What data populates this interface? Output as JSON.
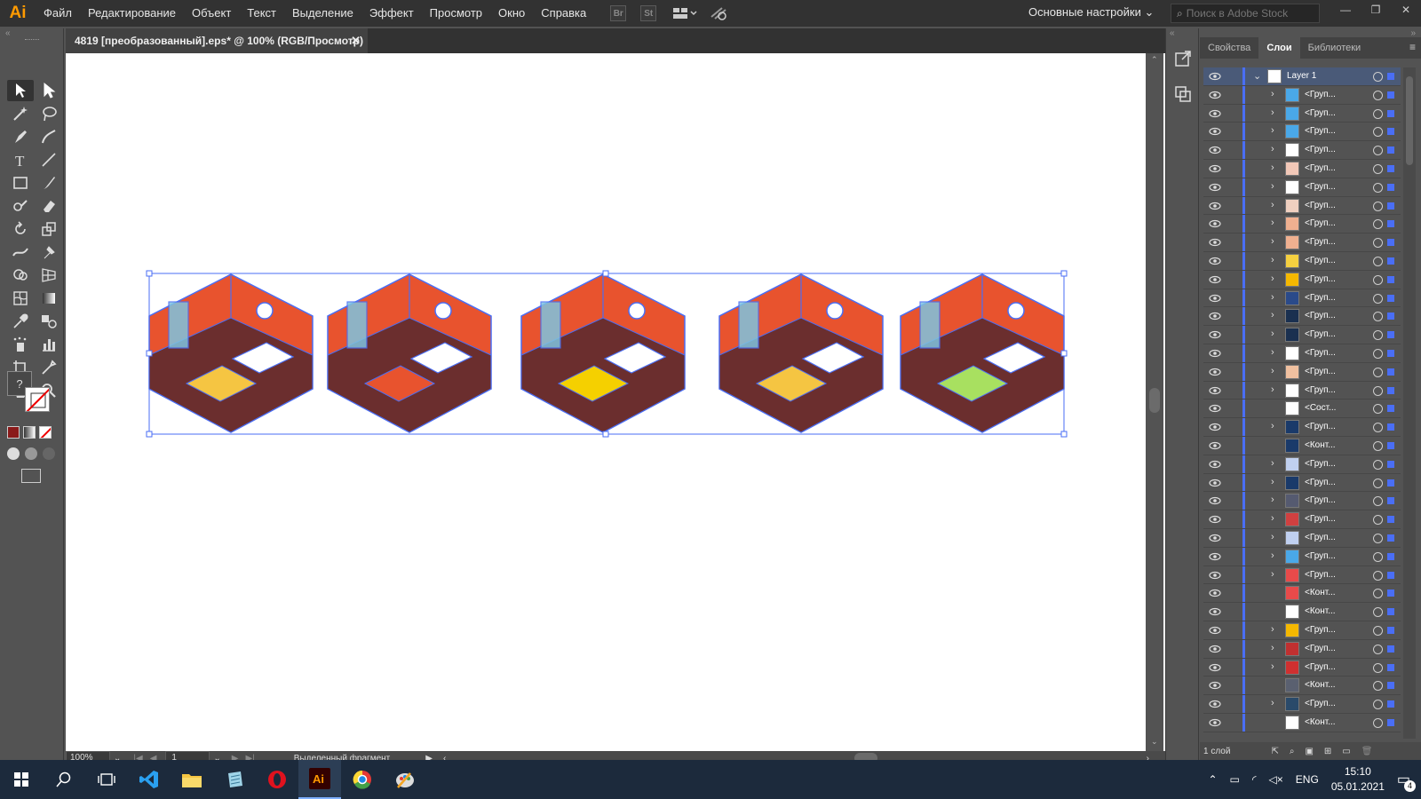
{
  "app": {
    "logo": "Ai"
  },
  "menu": [
    "Файл",
    "Редактирование",
    "Объект",
    "Текст",
    "Выделение",
    "Эффект",
    "Просмотр",
    "Окно",
    "Справка"
  ],
  "menubar_icons": [
    "Br",
    "St"
  ],
  "workspace": "Основные настройки",
  "search": {
    "placeholder": "Поиск в Adobe Stock"
  },
  "document_tab": {
    "title": "4819 [преобразованный].eps* @ 100% (RGB/Просмотр)"
  },
  "statusbar": {
    "zoom": "100%",
    "page": "1",
    "status": "Выделенный фрагмент"
  },
  "panel": {
    "tabs": [
      "Свойства",
      "Слои",
      "Библиотеки"
    ],
    "active_tab": "Слои",
    "footer": "1 слой",
    "layers": [
      {
        "name": "Layer 1",
        "thumb": "#ffffff",
        "expand": true
      },
      {
        "name": "<Груп...",
        "thumb": "#4aa8e8",
        "expand": true
      },
      {
        "name": "<Груп...",
        "thumb": "#4aa8e8",
        "expand": true
      },
      {
        "name": "<Груп...",
        "thumb": "#4aa8e8",
        "expand": true
      },
      {
        "name": "<Груп...",
        "thumb": "#ffffff",
        "expand": true
      },
      {
        "name": "<Груп...",
        "thumb": "#f2c8b8",
        "expand": true
      },
      {
        "name": "<Груп...",
        "thumb": "#ffffff",
        "expand": true
      },
      {
        "name": "<Груп...",
        "thumb": "#f0d0c0",
        "expand": true
      },
      {
        "name": "<Груп...",
        "thumb": "#f0b090",
        "expand": true
      },
      {
        "name": "<Груп...",
        "thumb": "#f0b090",
        "expand": true
      },
      {
        "name": "<Груп...",
        "thumb": "#f5d040",
        "expand": true
      },
      {
        "name": "<Груп...",
        "thumb": "#f5b800",
        "expand": true
      },
      {
        "name": "<Груп...",
        "thumb": "#2a4a8a",
        "expand": true
      },
      {
        "name": "<Груп...",
        "thumb": "#1a3050",
        "expand": true
      },
      {
        "name": "<Груп...",
        "thumb": "#1a3050",
        "expand": true
      },
      {
        "name": "<Груп...",
        "thumb": "#ffffff",
        "expand": true
      },
      {
        "name": "<Груп...",
        "thumb": "#f0c0a0",
        "expand": true
      },
      {
        "name": "<Груп...",
        "thumb": "#ffffff",
        "expand": true
      },
      {
        "name": "<Сост...",
        "thumb": "#ffffff",
        "expand": false
      },
      {
        "name": "<Груп...",
        "thumb": "#1a3a6a",
        "expand": true
      },
      {
        "name": "<Конт...",
        "thumb": "#1a3a6a",
        "expand": false
      },
      {
        "name": "<Груп...",
        "thumb": "#c0d0f0",
        "expand": true
      },
      {
        "name": "<Груп...",
        "thumb": "#1a3a6a",
        "expand": true
      },
      {
        "name": "<Груп...",
        "thumb": "#555a70",
        "expand": true
      },
      {
        "name": "<Груп...",
        "thumb": "#d04040",
        "expand": true
      },
      {
        "name": "<Груп...",
        "thumb": "#c0d0f0",
        "expand": true
      },
      {
        "name": "<Груп...",
        "thumb": "#4aa8e8",
        "expand": true
      },
      {
        "name": "<Груп...",
        "thumb": "#e84a4a",
        "expand": true
      },
      {
        "name": "<Конт...",
        "thumb": "#e84a4a",
        "expand": false
      },
      {
        "name": "<Конт...",
        "thumb": "#ffffff",
        "expand": false
      },
      {
        "name": "<Груп...",
        "thumb": "#f5b800",
        "expand": true
      },
      {
        "name": "<Груп...",
        "thumb": "#c03030",
        "expand": true
      },
      {
        "name": "<Груп...",
        "thumb": "#d03030",
        "expand": true
      },
      {
        "name": "<Конт...",
        "thumb": "#5a6070",
        "expand": false
      },
      {
        "name": "<Груп...",
        "thumb": "#2a4a6a",
        "expand": true
      },
      {
        "name": "<Конт...",
        "thumb": "#ffffff",
        "expand": false
      }
    ]
  },
  "taskbar": {
    "lang": "ENG",
    "time": "15:10",
    "date": "05.01.2021",
    "notifications": "4"
  },
  "colors": {
    "accent": "#4a6ef5",
    "room_wall": "#e8532e",
    "room_floor": "#6b2e2e"
  }
}
